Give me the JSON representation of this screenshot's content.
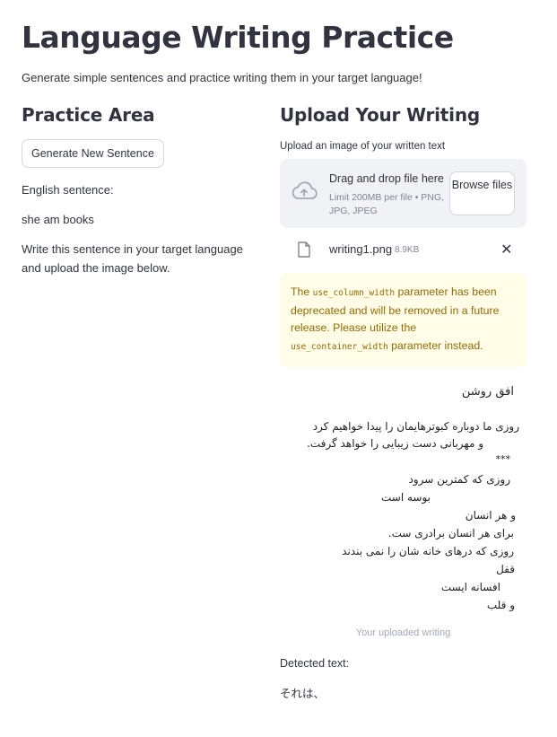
{
  "header": {
    "title": "Language Writing Practice",
    "subtitle": "Generate simple sentences and practice writing them in your target language!"
  },
  "practice": {
    "heading": "Practice Area",
    "generate_button": "Generate New Sentence",
    "english_label": "English sentence:",
    "sentence": "she am books",
    "instruction": "Write this sentence in your target language and upload the image below."
  },
  "upload": {
    "heading": "Upload Your Writing",
    "label": "Upload an image of your written text",
    "drop_text": "Drag and drop file here",
    "limit_text": "Limit 200MB per file • PNG, JPG, JPEG",
    "browse_button": "Browse files",
    "file": {
      "name": "writing1.png",
      "size": "8.9KB"
    },
    "warning": {
      "part1": "The ",
      "code1": "use_column_width",
      "part2": " parameter has been deprecated and will be removed in a future release. Please utilize the ",
      "code2": "use_container_width",
      "part3": " parameter instead."
    },
    "image_lines": [
      "افق روشن",
      "روزی ما دوباره کبوترهایمان را پیدا خواهیم کرد",
      "و مهربانی دست زیبایی را خواهد گرفت.",
      "***",
      "روزی که کمترین سرود",
      "بوسه است",
      "و هر انسان",
      "برای هر انسان برادری ست.",
      "روزی که درهای خانه شان را نمی بندند",
      "قفل",
      "افسانه ایست",
      "و قلب"
    ],
    "caption": "Your uploaded writing",
    "detected_label": "Detected text:",
    "detected_text": "それは、"
  }
}
